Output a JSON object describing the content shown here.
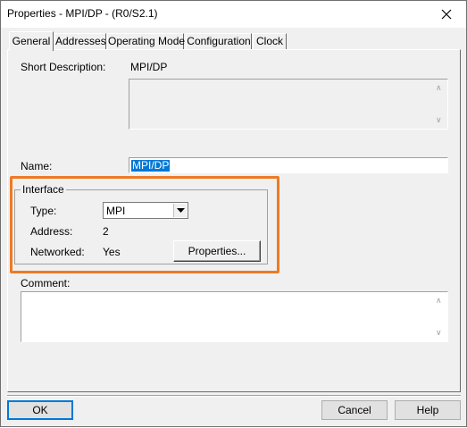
{
  "window": {
    "title": "Properties - MPI/DP - (R0/S2.1)"
  },
  "tabs": [
    {
      "label": "General",
      "active": true
    },
    {
      "label": "Addresses"
    },
    {
      "label": "Operating Mode"
    },
    {
      "label": "Configuration"
    },
    {
      "label": "Clock"
    }
  ],
  "general": {
    "short_description_label": "Short Description:",
    "short_description_value": "MPI/DP",
    "description_text": "",
    "name_label": "Name:",
    "name_value": "MPI/DP",
    "interface": {
      "legend": "Interface",
      "type_label": "Type:",
      "type_value": "MPI",
      "address_label": "Address:",
      "address_value": "2",
      "networked_label": "Networked:",
      "networked_value": "Yes",
      "properties_button": "Properties..."
    },
    "comment_label": "Comment:",
    "comment_value": ""
  },
  "footer": {
    "ok": "OK",
    "cancel": "Cancel",
    "help": "Help"
  },
  "highlight_color": "#ee7a24"
}
